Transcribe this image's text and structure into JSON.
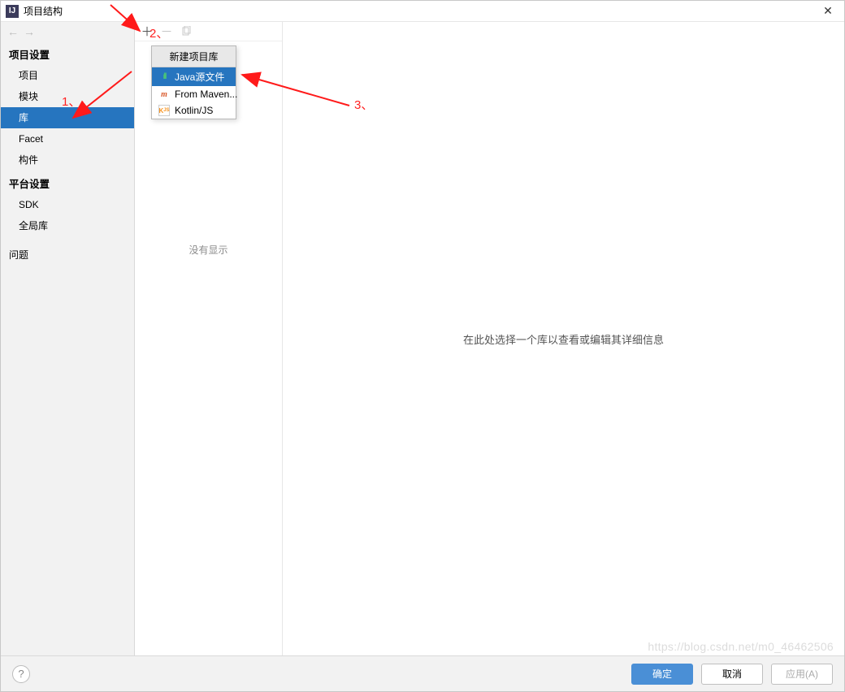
{
  "window": {
    "title": "项目结构"
  },
  "sidebar": {
    "sections": [
      {
        "header": "项目设置",
        "items": [
          {
            "label": "项目",
            "selected": false
          },
          {
            "label": "模块",
            "selected": false
          },
          {
            "label": "库",
            "selected": true
          },
          {
            "label": "Facet",
            "selected": false
          },
          {
            "label": "构件",
            "selected": false
          }
        ]
      },
      {
        "header": "平台设置",
        "items": [
          {
            "label": "SDK",
            "selected": false
          },
          {
            "label": "全局库",
            "selected": false
          }
        ]
      }
    ],
    "problems": "问题"
  },
  "middle": {
    "empty_hint": "没有显示"
  },
  "popup": {
    "header": "新建项目库",
    "items": [
      {
        "label": "Java源文件",
        "icon": "bars",
        "selected": true
      },
      {
        "label": "From Maven...",
        "icon": "m",
        "selected": false
      },
      {
        "label": "Kotlin/JS",
        "icon": "k",
        "selected": false
      }
    ]
  },
  "detail": {
    "placeholder": "在此处选择一个库以查看或编辑其详细信息"
  },
  "footer": {
    "ok": "确定",
    "cancel": "取消",
    "apply": "应用(A)"
  },
  "annotations": {
    "a1": "1、",
    "a2": "2、",
    "a3": "3、"
  },
  "watermark": "https://blog.csdn.net/m0_46462506"
}
